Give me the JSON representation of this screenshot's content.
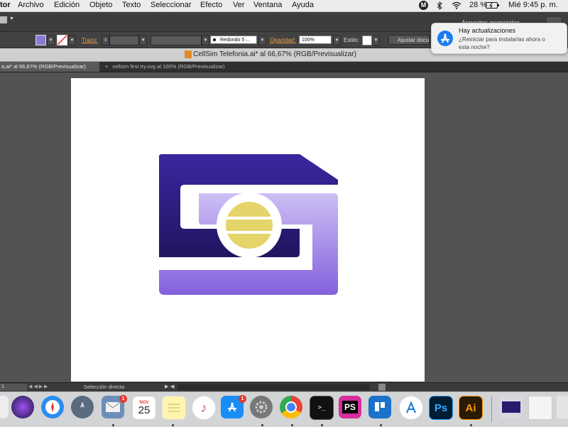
{
  "menubar": {
    "app_name": "tor",
    "items": [
      "Archivo",
      "Edición",
      "Objeto",
      "Texto",
      "Seleccionar",
      "Efecto",
      "Ver",
      "Ventana",
      "Ayuda"
    ],
    "battery": "28 %",
    "clock": "Mié 9:45 p. m."
  },
  "appbar": {
    "workspace": "Aspectos esenciales"
  },
  "controlbar": {
    "trazo_label": "Trazo:",
    "brush": "Redondo 5 ...",
    "opacity_label": "Opacidad:",
    "opacity_value": "100%",
    "style_label": "Estilo:",
    "adjust_button": "Ajustar docu"
  },
  "document": {
    "title": "CellSim Telefonia.ai* al 66,67% (RGB/Previsualizar)",
    "tabs": [
      {
        "label": "a.ai* al 66,67% (RGB/Previsualizar)",
        "active": true
      },
      {
        "label": "cellsim first try.svg al 100% (RGB/Previsualizar)",
        "active": false
      }
    ]
  },
  "statusbar": {
    "zoom": "1",
    "tool": "Selección directa"
  },
  "notification": {
    "title": "Hay actualizaciones",
    "body_line1": "¿Reiniciar para instalarlas ahora o",
    "body_line2": "esta noche?"
  },
  "dock": {
    "calendar_month": "NOV",
    "calendar_day": "25",
    "mail_badge": "1",
    "appstore_badge": "1",
    "ps_label": "Ps",
    "ai_label": "Ai",
    "ps2_label": "PS"
  },
  "colors": {
    "logo_dark": "#2a1a6e",
    "logo_light": "#8b6ee0",
    "logo_chip": "#e4d46a",
    "notif_icon": "#1d7cf2"
  }
}
